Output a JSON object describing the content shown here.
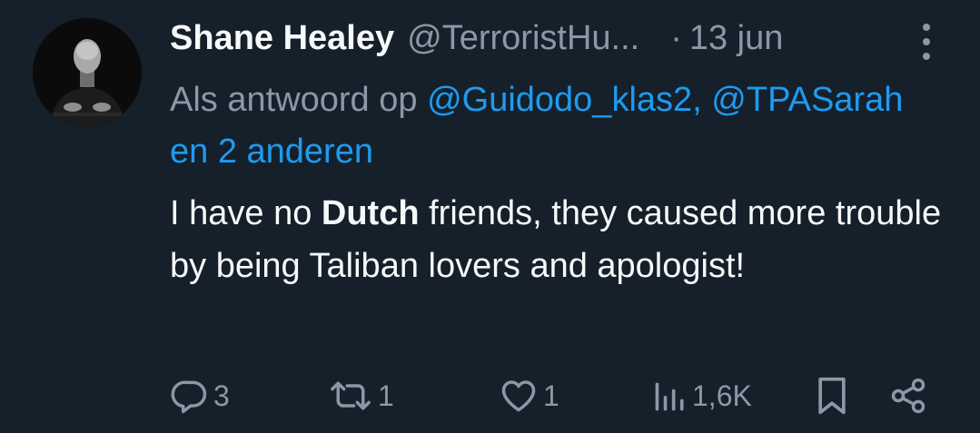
{
  "tweet": {
    "author": {
      "display_name": "Shane Healey",
      "handle": "@TerroristHu...",
      "avatar_icon": "profile-photo"
    },
    "separator": "·",
    "date": "13 jun",
    "reply_to": {
      "prefix": "Als antwoord op",
      "mention_1": "@Guidodo_klas2,",
      "mention_2": "@TPASarah",
      "suffix": "en 2 anderen"
    },
    "text": {
      "part_1": "I have no",
      "bold": "Dutch",
      "part_2": "friends, they caused more trouble by being Taliban lovers and apologist!"
    },
    "actions": {
      "replies": "3",
      "retweets": "1",
      "likes": "1",
      "views": "1,6K"
    }
  },
  "colors": {
    "background": "#15202b",
    "primary_text": "#f7f9f9",
    "secondary_text": "#8b98a5",
    "link": "#1d9bf0"
  }
}
